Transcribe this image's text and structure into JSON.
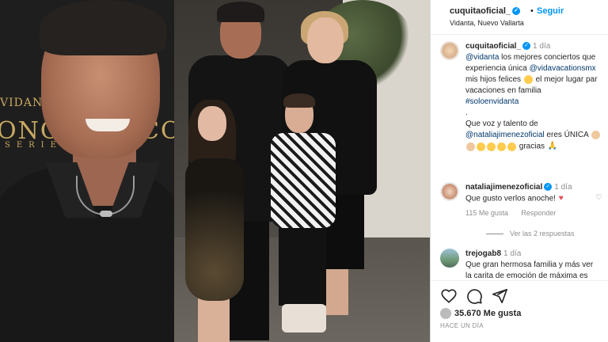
{
  "left_photo": {
    "sign_brand": "VIDANTA",
    "sign_big": "ONCER",
    "sign_small": "SERIES",
    "sign_right_fragment": "CO"
  },
  "header": {
    "username": "cuquitaoficial_",
    "follow_label": "Seguir",
    "dot": "•",
    "location": "Vidanta, Nuevo Vallarta"
  },
  "caption": {
    "username": "cuquitaoficial_",
    "time": "1 día",
    "line1_mention": "@vidanta",
    "line1_text": " los mejores conciertos que",
    "line2_text": "experiencia única ",
    "line2_mention": "@vidavacationsmx",
    "line3_text_a": "mis hijos felices ",
    "line3_text_b": " el mejor lugar par",
    "line4_text": "vacaciones en familia",
    "line5_hashtag": "#soloenvidanta",
    "line6_dot": ".",
    "line7_text": "Que voz y talento de",
    "line8_mention": "@nataliajimenezoficial",
    "line8_text": " eres ÚNICA",
    "line9_text": " gracias"
  },
  "comments": [
    {
      "username": "nataliajimenezoficial",
      "time": "1 día",
      "text": "Que gusto verlos anoche!",
      "likes": "115 Me gusta",
      "reply": "Responder",
      "view_replies": "Ver las 2 respuestas"
    },
    {
      "username": "trejogab8",
      "time": "1 día",
      "text_line1": "Que gran hermosa familia y más ver",
      "text_line2": "la carita de emoción de máxima es"
    }
  ],
  "footer": {
    "likes_count": "35.670",
    "likes_label": "Me gusta",
    "posted": "HACE UN DÍA"
  },
  "icons": {
    "heart": "heart-icon",
    "comment": "comment-icon",
    "share": "share-icon",
    "verified": "verified-badge-icon"
  },
  "colors": {
    "link": "#0095f6",
    "mention": "#00376b",
    "muted": "#8e8e8e",
    "heart": "#ed4956"
  }
}
